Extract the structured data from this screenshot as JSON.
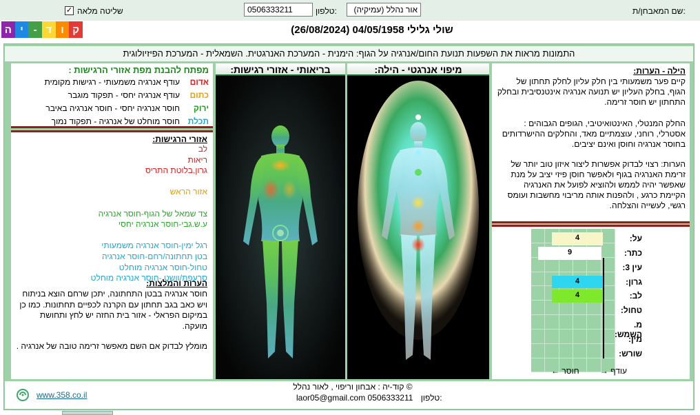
{
  "topbar": {
    "examiner_label": "שם המאבחן/ת:",
    "examiner_value": "אור נהלל (עמיקיה)",
    "phone_label": "טלפון:",
    "phone_value": "0506333211",
    "full_control_label": "שליטה מלאה",
    "full_control_checked": "✓"
  },
  "logo": {
    "letters": [
      "ק",
      "ו",
      "ד",
      "-",
      "י",
      "ה"
    ],
    "colors": [
      "#e53935",
      "#fb8c00",
      "#fdd835",
      "#43a047",
      "#1e88e5",
      "#8e24aa"
    ]
  },
  "patient": {
    "header": "שולי  גלילי  04/05/1958 (26/08/2024)"
  },
  "subtitle": "התמונות מראות את השפעות תנועת החום/אנרגיה על הגוף: הימנית - המערכת האנרגטית. השמאלית - המערכת הפיזיולוגית",
  "panels": {
    "aura_title": "מיפוי אנרגטי - הילה:",
    "body_title": "בריאותי - אזורי רגישות:"
  },
  "key": {
    "title": "מפתח להבנת מפת אזורי הרגישות :",
    "rows": [
      {
        "word": "אדום",
        "color": "#e02020",
        "text": "עודף אנרגיה משמעותי - רגישות מקומית"
      },
      {
        "word": "כתום",
        "color": "#f0a000",
        "text": "עודף  אנרגיה יחסי - תפקוד מוגבר"
      },
      {
        "word": "ירוק",
        "color": "#1c9a1c",
        "text": "חוסר אנרגיה יחסי - חוסר אנרגיה באיבר"
      },
      {
        "word": "תכלת",
        "color": "#20a8d8",
        "text": "חוסר מוחלט של אנרגיה  - תפקוד נמוך"
      }
    ]
  },
  "sensitivity": {
    "title": "אזורי הרגישות:",
    "items": [
      {
        "text": "לב",
        "color": "#e02020"
      },
      {
        "text": "ריאות",
        "color": "#e02020"
      },
      {
        "text": "גרון,בלוטת התריס",
        "color": "#e02020"
      },
      {
        "text": "",
        "color": "#000000"
      },
      {
        "text": "אזור הראש",
        "color": "#e0a000"
      },
      {
        "text": "",
        "color": "#000000"
      },
      {
        "text": "צד שמאל של הגוף-חוסר אנרגיה",
        "color": "#2aa82a"
      },
      {
        "text": "ע.ש.גבי-חוסר אנרגיה יחסי",
        "color": "#2aa82a"
      },
      {
        "text": "",
        "color": "#000000"
      },
      {
        "text": "רגל ימין-חוסר אנרגיה משמעותי",
        "color": "#20a8d8"
      },
      {
        "text": "בטן תחתונה/רחם-חוסר אנרגיה",
        "color": "#20a8d8"
      },
      {
        "text": "טחול-חוסר אנרגיה מוחלט",
        "color": "#20a8d8"
      },
      {
        "text": "סרעפת/וושט -חוסר אנרגיה מוחלט",
        "color": "#20a8d8"
      }
    ],
    "recs_title": "הערות והמלצות:",
    "recs_text": "חוסר אנרגיה בבטן התחתונה, יתכן שרחם הוצא בניתוח ויש כאב בגב תחתון  עם הקרנה לכפיים תחתונות. כמו כן במיקום הפראלי - אזור בית החזה יש לחץ ותחושת מועקה.",
    "recs_text2": "מומלץ לבדוק אם השם מאפשר זרימה טובה של אנרגיה ."
  },
  "notes": {
    "title": "הילה - הערות:",
    "p1": "קיים פער משמעותי בין חלק עליון לחלק תחתון של הגוף, בחלק העליון יש תנועה אנרגיה אינטנסיבית ובחלק התחתון יש חוסר זרימה.",
    "p2": "החלק המנטלי, האינטואיטיבי, הגופים הגבוהים : אסטרלי, רוחני, עוצמתיים מאד, והחלקים ההישרדותים בחוסר אנרגיה וחוסן ואינם יציבים.",
    "p3": "הערות: רצוי לבדוק אפשרות ליצור איזון טוב יותר של זרימת האנרגיה בגוף ולאפשר חוסן פיזי יציב על מנת שאפשר יהיה לממש ולהוציא לפועל את האנרגיה הקיימת כרגע , ולהפנות אותה מריבוי מחשבות ועומס רגשי, לעשייה והצלחה."
  },
  "chakra_grid": {
    "rows": [
      {
        "label": "על:",
        "value": "4",
        "color": "#f8f5c8"
      },
      {
        "label": "כתר:",
        "value": "9",
        "color": "#ffffff"
      },
      {
        "label": "עין 3:",
        "value": "",
        "color": ""
      },
      {
        "label": "גרון:",
        "value": "4",
        "color": "#2ed6f0"
      },
      {
        "label": "לב:",
        "value": "4",
        "color": "#7ee82a"
      },
      {
        "label": "טחול:",
        "value": "",
        "color": ""
      },
      {
        "label": "מ. השמש:",
        "value": "",
        "color": ""
      },
      {
        "label": "מין:",
        "value": "",
        "color": ""
      },
      {
        "label": "שורש:",
        "value": "",
        "color": ""
      }
    ],
    "legend_left": "חוסר",
    "legend_right": "עודף"
  },
  "footer": {
    "copyright": "© קוד-יה : אבחון וריפוי , לאור נהלל",
    "contact_label": "טלפון:",
    "contact_value": "laor05@gmail.com 0506333211",
    "website": "www.358.co.il"
  }
}
